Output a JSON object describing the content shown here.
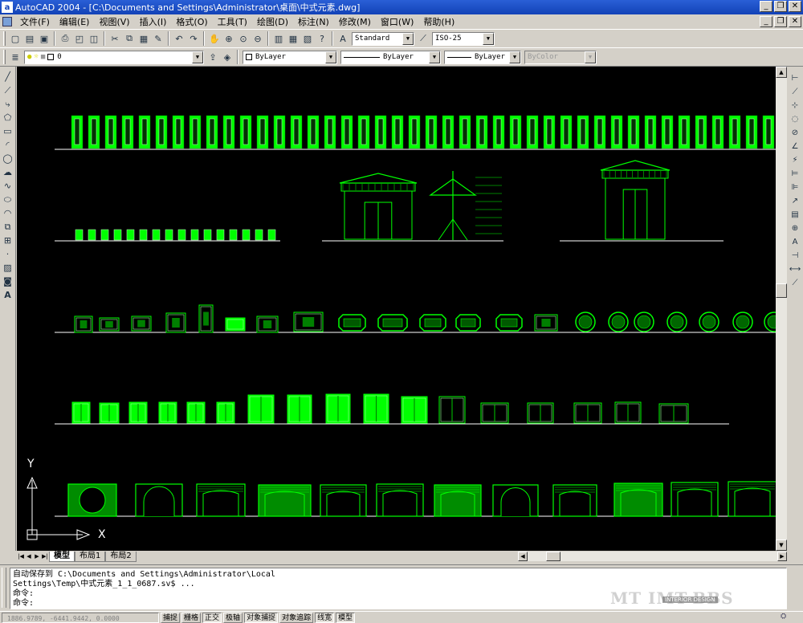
{
  "window": {
    "title": "AutoCAD 2004 - [C:\\Documents and Settings\\Administrator\\桌面\\中式元素.dwg]",
    "app_icon": "autocad-logo-icon"
  },
  "menu": [
    "文件(F)",
    "编辑(E)",
    "视图(V)",
    "插入(I)",
    "格式(O)",
    "工具(T)",
    "绘图(D)",
    "标注(N)",
    "修改(M)",
    "窗口(W)",
    "帮助(H)"
  ],
  "toolbar_standard": {
    "text_style": "Standard",
    "dim_style": "ISO-25"
  },
  "toolbar_layers": {
    "layer": "0",
    "color": "ByLayer",
    "linetype": "ByLayer",
    "lineweight": "ByLayer",
    "plot_style": "ByColor"
  },
  "ucs": {
    "y_label": "Y",
    "x_label": "X"
  },
  "tabs": [
    "模型",
    "布局1",
    "布局2"
  ],
  "active_tab": "模型",
  "command_lines": [
    "自动保存到 C:\\Documents and Settings\\Administrator\\Local",
    "Settings\\Temp\\中式元素_1_1_0687.sv$ ...",
    "命令:",
    "命令:"
  ],
  "status": {
    "coordinates": "1886.9789, -6441.9442, 0.0000",
    "toggles": [
      "捕捉",
      "栅格",
      "正交",
      "极轴",
      "对象捕捉",
      "对象追踪",
      "线宽",
      "模型"
    ],
    "toggles_on": [
      "正交",
      "对象捕捉",
      "线宽",
      "模型"
    ]
  },
  "watermark": {
    "main": "MT    IMT-BBS",
    "sub": "INTERIOR DESIGN"
  },
  "colors": {
    "canvas": "#000000",
    "entity": "#00ff00",
    "baseline": "#ffffff",
    "accent": "#1242b7"
  }
}
